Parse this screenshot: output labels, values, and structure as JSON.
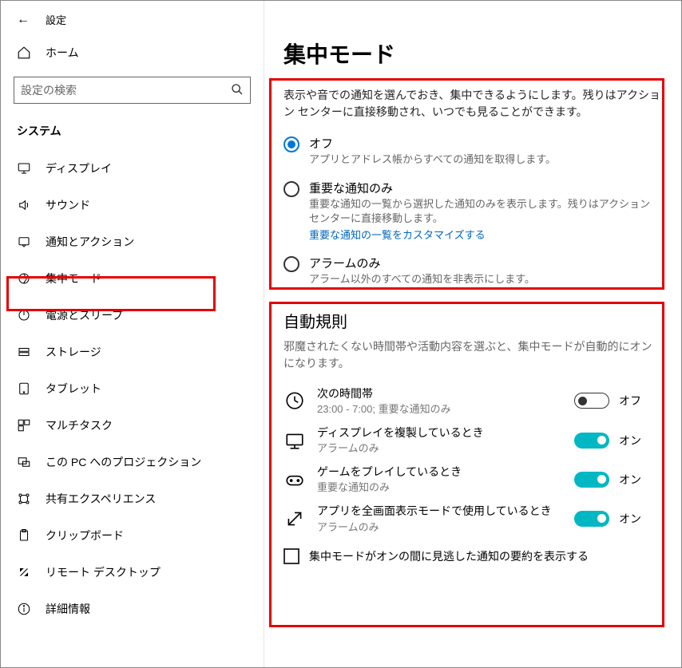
{
  "header": {
    "settings": "設定",
    "home": "ホーム",
    "search_placeholder": "設定の検索",
    "category": "システム"
  },
  "nav": [
    {
      "icon": "display",
      "label": "ディスプレイ"
    },
    {
      "icon": "sound",
      "label": "サウンド"
    },
    {
      "icon": "notify",
      "label": "通知とアクション"
    },
    {
      "icon": "focus",
      "label": "集中モード",
      "active": true
    },
    {
      "icon": "power",
      "label": "電源とスリープ"
    },
    {
      "icon": "storage",
      "label": "ストレージ"
    },
    {
      "icon": "tablet",
      "label": "タブレット"
    },
    {
      "icon": "multitask",
      "label": "マルチタスク"
    },
    {
      "icon": "project",
      "label": "この PC へのプロジェクション"
    },
    {
      "icon": "share",
      "label": "共有エクスペリエンス"
    },
    {
      "icon": "clipboard",
      "label": "クリップボード"
    },
    {
      "icon": "remote",
      "label": "リモート デスクトップ"
    },
    {
      "icon": "about",
      "label": "詳細情報"
    }
  ],
  "main": {
    "title": "集中モード",
    "desc": "表示や音での通知を選んでおき、集中できるようにします。残りはアクション センターに直接移動され、いつでも見ることができます。",
    "radios": [
      {
        "label": "オフ",
        "desc": "アプリとアドレス帳からすべての通知を取得します。",
        "selected": true
      },
      {
        "label": "重要な通知のみ",
        "desc": "重要な通知の一覧から選択した通知のみを表示します。残りはアクション センターに直接移動します。",
        "link": "重要な通知の一覧をカスタマイズする"
      },
      {
        "label": "アラームのみ",
        "desc": "アラーム以外のすべての通知を非表示にします。"
      }
    ],
    "auto_title": "自動規則",
    "auto_desc": "邪魔されたくない時間帯や活動内容を選ぶと、集中モードが自動的にオンになります。",
    "rules": [
      {
        "icon": "clock",
        "label": "次の時間帯",
        "sub": "23:00 - 7:00; 重要な通知のみ",
        "on": false,
        "state": "オフ"
      },
      {
        "icon": "monitor",
        "label": "ディスプレイを複製しているとき",
        "sub": "アラームのみ",
        "on": true,
        "state": "オン"
      },
      {
        "icon": "game",
        "label": "ゲームをプレイしているとき",
        "sub": "重要な通知のみ",
        "on": true,
        "state": "オン"
      },
      {
        "icon": "fullscreen",
        "label": "アプリを全画面表示モードで使用しているとき",
        "sub": "アラームのみ",
        "on": true,
        "state": "オン"
      }
    ],
    "checkbox": "集中モードがオンの間に見逃した通知の要約を表示する"
  }
}
